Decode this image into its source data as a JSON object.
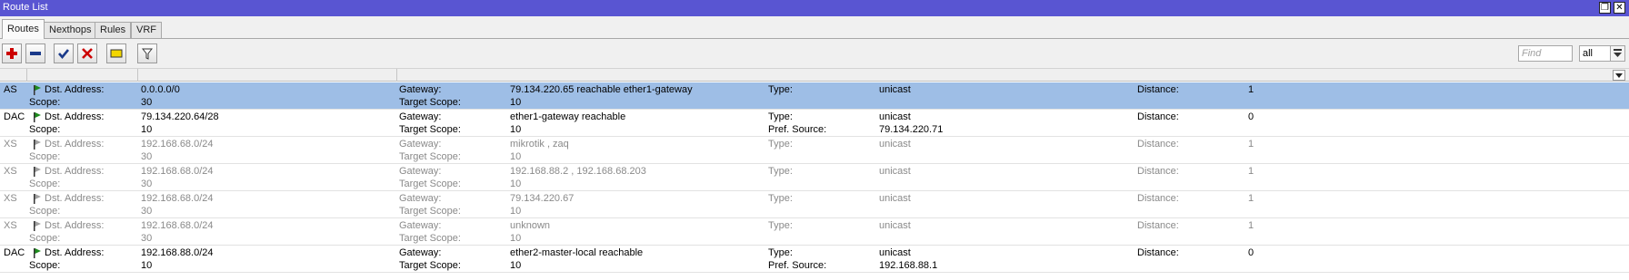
{
  "window": {
    "title": "Route List",
    "restore_glyph": "❐",
    "close_glyph": "✕"
  },
  "tabs": [
    {
      "label": "Routes",
      "active": true
    },
    {
      "label": "Nexthops",
      "active": false
    },
    {
      "label": "Rules",
      "active": false
    },
    {
      "label": "VRF",
      "active": false
    }
  ],
  "toolbar": {
    "buttons": [
      {
        "name": "add-button",
        "icon": "plus-icon",
        "color": "#cc0000"
      },
      {
        "name": "remove-button",
        "icon": "minus-icon",
        "color": "#1a3a8a"
      },
      {
        "name": "enable-button",
        "icon": "check-icon",
        "color": "#1a3a8a"
      },
      {
        "name": "disable-button",
        "icon": "cross-icon",
        "color": "#cc0000"
      },
      {
        "name": "comment-button",
        "icon": "comment-icon",
        "color": "#f2d600"
      },
      {
        "name": "filter-button",
        "icon": "filter-icon",
        "color": "#333333"
      }
    ],
    "find_placeholder": "Find",
    "filter_value": "all"
  },
  "field_labels": {
    "dst": "Dst. Address:",
    "scope": "Scope:",
    "gateway": "Gateway:",
    "target_scope": "Target Scope:",
    "type": "Type:",
    "pref_source": "Pref. Source:",
    "distance": "Distance:"
  },
  "routes": [
    {
      "flags": "AS",
      "dst": "0.0.0.0/0",
      "scope": "30",
      "gateway": "79.134.220.65 reachable ether1-gateway",
      "target_scope": "10",
      "type": "unicast",
      "pref_source": "",
      "distance": "1",
      "selected": true,
      "dim": false,
      "flag_active": true
    },
    {
      "flags": "DAC",
      "dst": "79.134.220.64/28",
      "scope": "10",
      "gateway": "ether1-gateway reachable",
      "target_scope": "10",
      "type": "unicast",
      "pref_source": "79.134.220.71",
      "distance": "0",
      "selected": false,
      "dim": false,
      "flag_active": true
    },
    {
      "flags": "XS",
      "dst": "192.168.68.0/24",
      "scope": "30",
      "gateway": "mikrotik  , zaq",
      "target_scope": "10",
      "type": "unicast",
      "pref_source": "",
      "distance": "1",
      "selected": false,
      "dim": true,
      "flag_active": false
    },
    {
      "flags": "XS",
      "dst": "192.168.68.0/24",
      "scope": "30",
      "gateway": "192.168.88.2  , 192.168.68.203",
      "target_scope": "10",
      "type": "unicast",
      "pref_source": "",
      "distance": "1",
      "selected": false,
      "dim": true,
      "flag_active": false
    },
    {
      "flags": "XS",
      "dst": "192.168.68.0/24",
      "scope": "30",
      "gateway": "79.134.220.67",
      "target_scope": "10",
      "type": "unicast",
      "pref_source": "",
      "distance": "1",
      "selected": false,
      "dim": true,
      "flag_active": false
    },
    {
      "flags": "XS",
      "dst": "192.168.68.0/24",
      "scope": "30",
      "gateway": "unknown",
      "target_scope": "10",
      "type": "unicast",
      "pref_source": "",
      "distance": "1",
      "selected": false,
      "dim": true,
      "flag_active": false
    },
    {
      "flags": "DAC",
      "dst": "192.168.88.0/24",
      "scope": "10",
      "gateway": "ether2-master-local reachable",
      "target_scope": "10",
      "type": "unicast",
      "pref_source": "192.168.88.1",
      "distance": "0",
      "selected": false,
      "dim": false,
      "flag_active": true
    }
  ]
}
